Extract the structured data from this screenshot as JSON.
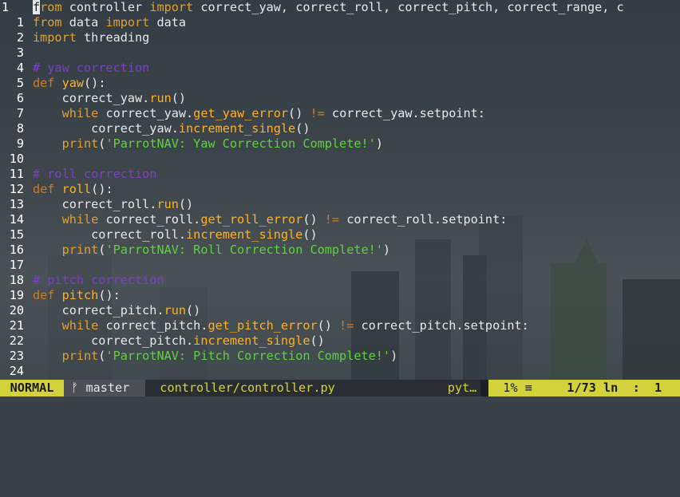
{
  "editor": {
    "lines": [
      {
        "num": "1",
        "current": true,
        "segments": [
          {
            "t": "f",
            "c": "cursor"
          },
          {
            "t": "rom",
            "c": "kw"
          },
          {
            "t": " controller ",
            "c": ""
          },
          {
            "t": "import",
            "c": "kw"
          },
          {
            "t": " correct_yaw, correct_roll, correct_pitch, correct_range, c",
            "c": ""
          }
        ]
      },
      {
        "num": "1",
        "segments": [
          {
            "t": "from",
            "c": "kw"
          },
          {
            "t": " data ",
            "c": ""
          },
          {
            "t": "import",
            "c": "kw"
          },
          {
            "t": " data",
            "c": ""
          }
        ]
      },
      {
        "num": "2",
        "segments": [
          {
            "t": "import",
            "c": "kw"
          },
          {
            "t": " threading",
            "c": ""
          }
        ]
      },
      {
        "num": "3",
        "segments": []
      },
      {
        "num": "4",
        "segments": [
          {
            "t": "# yaw correction",
            "c": "cmt"
          }
        ]
      },
      {
        "num": "5",
        "segments": [
          {
            "t": "def",
            "c": "kw2"
          },
          {
            "t": " ",
            "c": ""
          },
          {
            "t": "yaw",
            "c": "fn"
          },
          {
            "t": "():",
            "c": ""
          }
        ]
      },
      {
        "num": "6",
        "segments": [
          {
            "t": "    correct_yaw.",
            "c": ""
          },
          {
            "t": "run",
            "c": "fn"
          },
          {
            "t": "()",
            "c": ""
          }
        ]
      },
      {
        "num": "7",
        "segments": [
          {
            "t": "    ",
            "c": ""
          },
          {
            "t": "while",
            "c": "kw"
          },
          {
            "t": " correct_yaw.",
            "c": ""
          },
          {
            "t": "get_yaw_error",
            "c": "fn"
          },
          {
            "t": "() ",
            "c": ""
          },
          {
            "t": "!=",
            "c": "kw2"
          },
          {
            "t": " correct_yaw.setpoint:",
            "c": ""
          }
        ]
      },
      {
        "num": "8",
        "segments": [
          {
            "t": "        correct_yaw.",
            "c": ""
          },
          {
            "t": "increment_single",
            "c": "fn"
          },
          {
            "t": "()",
            "c": ""
          }
        ]
      },
      {
        "num": "9",
        "segments": [
          {
            "t": "    ",
            "c": ""
          },
          {
            "t": "print",
            "c": "kw"
          },
          {
            "t": "(",
            "c": ""
          },
          {
            "t": "'ParrotNAV: Yaw Correction Complete!'",
            "c": "str"
          },
          {
            "t": ")",
            "c": ""
          }
        ]
      },
      {
        "num": "10",
        "segments": []
      },
      {
        "num": "11",
        "segments": [
          {
            "t": "# roll correction",
            "c": "cmt"
          }
        ]
      },
      {
        "num": "12",
        "segments": [
          {
            "t": "def",
            "c": "kw2"
          },
          {
            "t": " ",
            "c": ""
          },
          {
            "t": "roll",
            "c": "fn"
          },
          {
            "t": "():",
            "c": ""
          }
        ]
      },
      {
        "num": "13",
        "segments": [
          {
            "t": "    correct_roll.",
            "c": ""
          },
          {
            "t": "run",
            "c": "fn"
          },
          {
            "t": "()",
            "c": ""
          }
        ]
      },
      {
        "num": "14",
        "segments": [
          {
            "t": "    ",
            "c": ""
          },
          {
            "t": "while",
            "c": "kw"
          },
          {
            "t": " correct_roll.",
            "c": ""
          },
          {
            "t": "get_roll_error",
            "c": "fn"
          },
          {
            "t": "() ",
            "c": ""
          },
          {
            "t": "!=",
            "c": "kw2"
          },
          {
            "t": " correct_roll.setpoint:",
            "c": ""
          }
        ]
      },
      {
        "num": "15",
        "segments": [
          {
            "t": "        correct_roll.",
            "c": ""
          },
          {
            "t": "increment_single",
            "c": "fn"
          },
          {
            "t": "()",
            "c": ""
          }
        ]
      },
      {
        "num": "16",
        "segments": [
          {
            "t": "    ",
            "c": ""
          },
          {
            "t": "print",
            "c": "kw"
          },
          {
            "t": "(",
            "c": ""
          },
          {
            "t": "'ParrotNAV: Roll Correction Complete!'",
            "c": "str"
          },
          {
            "t": ")",
            "c": ""
          }
        ]
      },
      {
        "num": "17",
        "segments": []
      },
      {
        "num": "18",
        "segments": [
          {
            "t": "# pitch correction",
            "c": "cmt"
          }
        ]
      },
      {
        "num": "19",
        "segments": [
          {
            "t": "def",
            "c": "kw2"
          },
          {
            "t": " ",
            "c": ""
          },
          {
            "t": "pitch",
            "c": "fn"
          },
          {
            "t": "():",
            "c": ""
          }
        ]
      },
      {
        "num": "20",
        "segments": [
          {
            "t": "    correct_pitch.",
            "c": ""
          },
          {
            "t": "run",
            "c": "fn"
          },
          {
            "t": "()",
            "c": ""
          }
        ]
      },
      {
        "num": "21",
        "segments": [
          {
            "t": "    ",
            "c": ""
          },
          {
            "t": "while",
            "c": "kw"
          },
          {
            "t": " correct_pitch.",
            "c": ""
          },
          {
            "t": "get_pitch_error",
            "c": "fn"
          },
          {
            "t": "() ",
            "c": ""
          },
          {
            "t": "!=",
            "c": "kw2"
          },
          {
            "t": " correct_pitch.setpoint:",
            "c": ""
          }
        ]
      },
      {
        "num": "22",
        "segments": [
          {
            "t": "        correct_pitch.",
            "c": ""
          },
          {
            "t": "increment_single",
            "c": "fn"
          },
          {
            "t": "()",
            "c": ""
          }
        ]
      },
      {
        "num": "23",
        "segments": [
          {
            "t": "    ",
            "c": ""
          },
          {
            "t": "print",
            "c": "kw"
          },
          {
            "t": "(",
            "c": ""
          },
          {
            "t": "'ParrotNAV: Pitch Correction Complete!'",
            "c": "str"
          },
          {
            "t": ")",
            "c": ""
          }
        ]
      },
      {
        "num": "24",
        "segments": []
      }
    ]
  },
  "status": {
    "mode": "NORMAL",
    "branch_icon": "branch-icon",
    "branch_glyph": "ᚠ",
    "branch": "master",
    "file": "controller/controller.py",
    "filetype": "pyt…",
    "percent": "1%",
    "percent_glyph": "≡",
    "position": "1/73 ln  :  1"
  },
  "colors": {
    "keyword": "#e0a030",
    "function": "#ffb020",
    "string": "#60d040",
    "comment": "#7b3fc0",
    "statusline_accent": "#d2d23a"
  }
}
